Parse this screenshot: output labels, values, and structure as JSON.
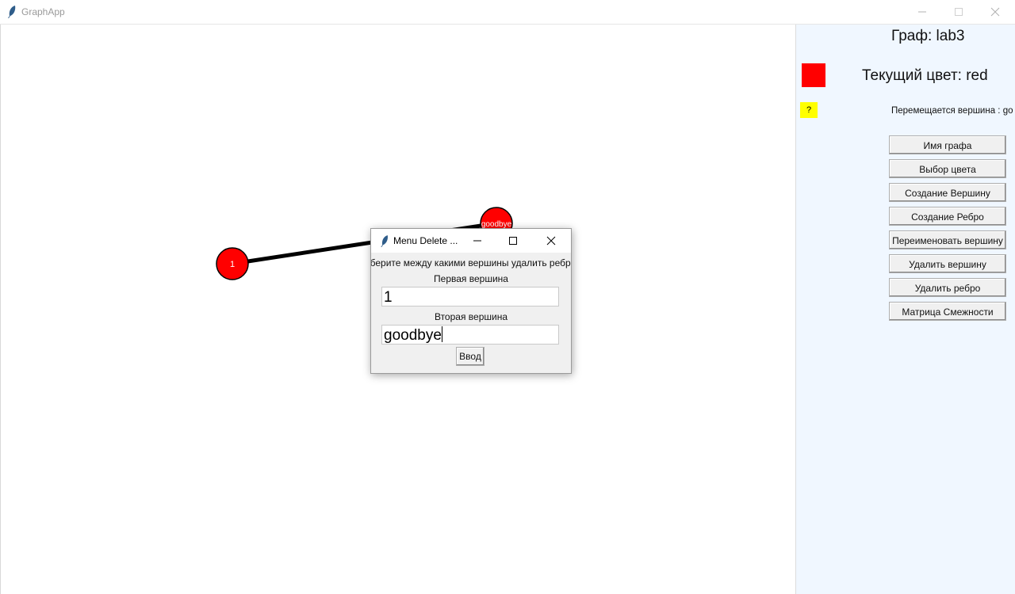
{
  "window": {
    "title": "GraphApp"
  },
  "graph": {
    "vertices": [
      {
        "label": "1",
        "color": "#ff0000"
      },
      {
        "label": "goodbye",
        "color": "#ff0000"
      }
    ],
    "edges": [
      {
        "from": "1",
        "to": "goodbye"
      }
    ]
  },
  "panel": {
    "graph_name": "Граф: lab3",
    "current_color_label": "Текущий цвет: red",
    "current_color": "#ff0000",
    "help_label": "?",
    "moving_vertex": "Перемещается вершина : go",
    "buttons": [
      "Имя графа",
      "Выбор цвета",
      "Создание Вершину",
      "Создание Ребро",
      "Переименовать вершину",
      "Удалить вершину",
      "Удалить ребро",
      "Матрица Смежности"
    ]
  },
  "dialog": {
    "title": "Menu Delete ...",
    "prompt": "ыберите между какими вершины удалить ребро",
    "first_label": "Первая вершина",
    "first_value": "1",
    "second_label": "Вторая вершина",
    "second_value": "goodbye",
    "submit_label": "Ввод"
  }
}
